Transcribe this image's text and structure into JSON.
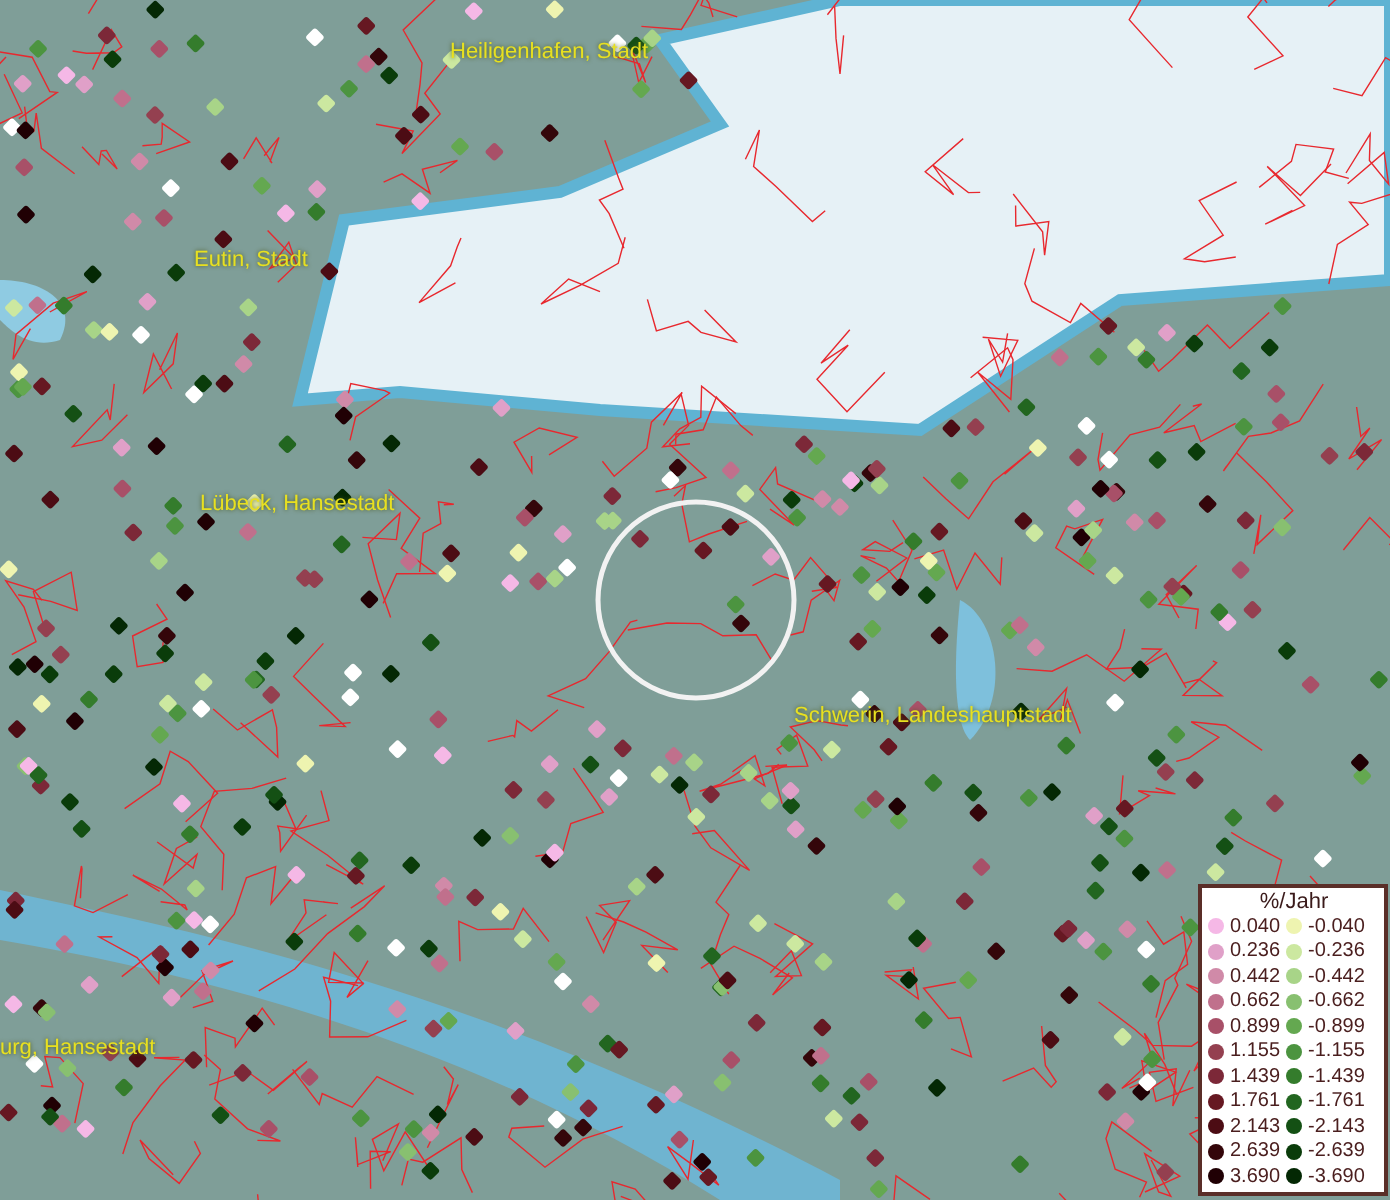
{
  "map": {
    "place_labels": [
      "Heiligenhafen, Stadt",
      "Eutin, Stadt",
      "Lübeck, Hansestadt",
      "Schwerin, Landeshauptstadt",
      "urg, Hansestadt"
    ]
  },
  "legend": {
    "title": "%/Jahr",
    "positive": [
      {
        "value": "0.040",
        "color": "#f5b8e6"
      },
      {
        "value": "0.236",
        "color": "#e0a0c8"
      },
      {
        "value": "0.442",
        "color": "#d08aa8"
      },
      {
        "value": "0.662",
        "color": "#c0708c"
      },
      {
        "value": "0.899",
        "color": "#a85068"
      },
      {
        "value": "1.155",
        "color": "#944050"
      },
      {
        "value": "1.439",
        "color": "#7c2838"
      },
      {
        "value": "1.761",
        "color": "#661822"
      },
      {
        "value": "2.143",
        "color": "#4c0c14"
      },
      {
        "value": "2.639",
        "color": "#34060a"
      },
      {
        "value": "3.690",
        "color": "#200004"
      }
    ],
    "negative": [
      {
        "value": "-0.040",
        "color": "#eef4b0"
      },
      {
        "value": "-0.236",
        "color": "#cce8a0"
      },
      {
        "value": "-0.442",
        "color": "#a8d488"
      },
      {
        "value": "-0.662",
        "color": "#88c070"
      },
      {
        "value": "-0.899",
        "color": "#64a850"
      },
      {
        "value": "-1.155",
        "color": "#4c9440"
      },
      {
        "value": "-1.439",
        "color": "#347c2c"
      },
      {
        "value": "-1.761",
        "color": "#226620"
      },
      {
        "value": "-2.143",
        "color": "#145014"
      },
      {
        "value": "-2.639",
        "color": "#0a3c0a"
      },
      {
        "value": "-3.690",
        "color": "#042804"
      }
    ]
  }
}
